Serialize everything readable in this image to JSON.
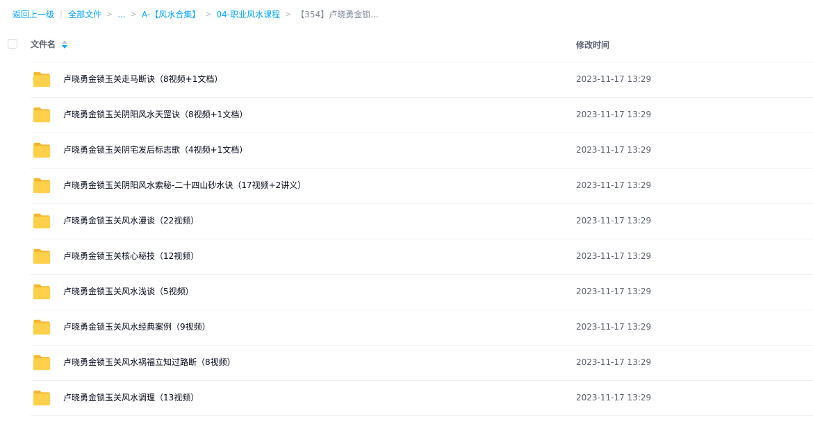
{
  "breadcrumb": {
    "back": "返回上一级",
    "pipe": "|",
    "root": "全部文件",
    "sep": ">",
    "ellipsis": "...",
    "level1": "A-【风水合集】",
    "level2": "04-职业风水课程",
    "current": "【354】卢晓勇金锁..."
  },
  "table": {
    "col_name": "文件名",
    "col_time": "修改时间",
    "sort_direction": "descending",
    "rows": [
      {
        "name": "卢晓勇金锁玉关走马断诀（8视频+1文档）",
        "time": "2023-11-17 13:29",
        "type": "folder"
      },
      {
        "name": "卢晓勇金锁玉关阴阳风水天罡诀（8视频+1文档）",
        "time": "2023-11-17 13:29",
        "type": "folder"
      },
      {
        "name": "卢晓勇金锁玉关阴宅发后标志歌（4视频+1文档）",
        "time": "2023-11-17 13:29",
        "type": "folder"
      },
      {
        "name": "卢晓勇金锁玉关阴阳风水索秘-二十四山砂水诀（17视频+2讲义）",
        "time": "2023-11-17 13:29",
        "type": "folder"
      },
      {
        "name": "卢晓勇金锁玉关风水漫谈（22视频）",
        "time": "2023-11-17 13:29",
        "type": "folder"
      },
      {
        "name": "卢晓勇金锁玉关核心秘技（12视频）",
        "time": "2023-11-17 13:29",
        "type": "folder"
      },
      {
        "name": "卢晓勇金锁玉关风水浅谈（5视频）",
        "time": "2023-11-17 13:29",
        "type": "folder"
      },
      {
        "name": "卢晓勇金锁玉关风水经典案例（9视频）",
        "time": "2023-11-17 13:29",
        "type": "folder"
      },
      {
        "name": "卢晓勇金锁玉关风水祸福立知过路断（8视频）",
        "time": "2023-11-17 13:29",
        "type": "folder"
      },
      {
        "name": "卢晓勇金锁玉关风水调理（13视频）",
        "time": "2023-11-17 13:29",
        "type": "folder"
      }
    ]
  },
  "colors": {
    "link": "#06a7ff",
    "folder_body": "#ffd04b",
    "folder_back": "#f5b731",
    "text_primary": "#03081a",
    "text_secondary": "#5c6270"
  }
}
